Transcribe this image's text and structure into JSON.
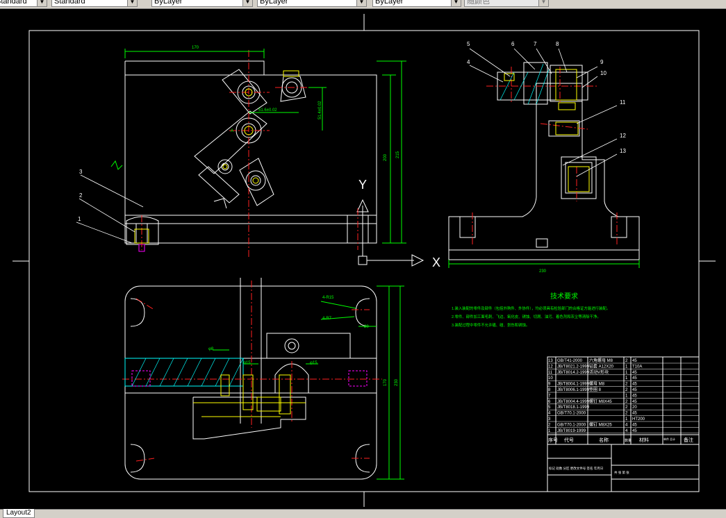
{
  "toolbar": {
    "text_style": "Standard",
    "layer": "ByLayer",
    "linetype": "ByLayer",
    "lineweight": "ByLayer",
    "plot_style": "随颜色"
  },
  "status": {
    "layout_tab": "Layout2"
  },
  "drawing": {
    "dims": {
      "top_width": "170",
      "height_200": "200",
      "height_215": "215",
      "d_51_6": "51.6±0.02",
      "d_51_4": "51.4±0.02",
      "base_width": "230",
      "plan_height": "170",
      "plan_total": "230",
      "r15": "4-R15",
      "r7": "4-R7",
      "d20": "20",
      "phi8": "φ8",
      "phi15": "φ15",
      "phi15b": "φ15",
      "aa": "A"
    },
    "leaders_left": [
      "1",
      "2",
      "3"
    ],
    "leaders_right": [
      "4",
      "5",
      "6",
      "7",
      "8",
      "9",
      "10",
      "11",
      "12",
      "13"
    ],
    "axes": {
      "y": "Y",
      "x": "X"
    },
    "tech": {
      "title": "技术要求",
      "lines": [
        "1.装入装配的零件及部件（包括外购件、外协件），均必须具有检验部门的合格证方能进行装配。",
        "2.零件、部件加工面毛刺、飞边、氧化皮、锈蚀、切屑、油污、着色剂和灰尘等清除干净。",
        "3.装配过程中零件不允许磕、碰、划伤和锈蚀。"
      ]
    },
    "bom": [
      {
        "no": "13",
        "code": "GB/T41-2000",
        "name": "六角螺母 M8",
        "qty": "2",
        "mat": "45"
      },
      {
        "no": "12",
        "code": "JB/T8021.2-1999",
        "name": "钻套 A12X20",
        "qty": "1",
        "mat": "T10A"
      },
      {
        "no": "11",
        "code": "JB/T8014.2-1999",
        "name": "活动V形块",
        "qty": "1",
        "mat": "45"
      },
      {
        "no": "10",
        "code": "",
        "name": "",
        "qty": "1",
        "mat": "45"
      },
      {
        "no": "9",
        "code": "JB/T8004.1-1999",
        "name": "螺母 M8",
        "qty": "2",
        "mat": "45"
      },
      {
        "no": "8",
        "code": "JB/T8006.1-1999",
        "name": "垫圈 8",
        "qty": "2",
        "mat": "45"
      },
      {
        "no": "7",
        "code": "",
        "name": "",
        "qty": "1",
        "mat": "45"
      },
      {
        "no": "6",
        "code": "JB/T8004.4-1999",
        "name": "螺钉 M8X45",
        "qty": "2",
        "mat": "45"
      },
      {
        "no": "5",
        "code": "JB/T8018.1-1999",
        "name": "",
        "qty": "2",
        "mat": "20"
      },
      {
        "no": "4",
        "code": "GB/T70.1-2000",
        "name": "",
        "qty": "2",
        "mat": "45"
      },
      {
        "no": "3",
        "code": "",
        "name": "",
        "qty": "1",
        "mat": "HT200"
      },
      {
        "no": "2",
        "code": "GB/T70.1-2000",
        "name": "螺钉 M8X25",
        "qty": "4",
        "mat": "45"
      },
      {
        "no": "1",
        "code": "JB/T8019-1999",
        "name": "",
        "qty": "4",
        "mat": "45"
      }
    ],
    "bom_header": {
      "no": "序号",
      "code": "代号",
      "name": "名称",
      "qty": "数量",
      "mat": "材料",
      "weight": "单件 总计",
      "note": "备注"
    },
    "title_block": {
      "sheet": "共 张 第 张",
      "labels": "标记 处数 分区 更改文件号 签名 年月日"
    }
  },
  "colors": {
    "bg": "#000000",
    "white": "#ffffff",
    "red": "#ff2020",
    "green": "#00ff00",
    "yellow": "#ffff00",
    "cyan": "#00ffff",
    "magenta": "#ff00ff"
  }
}
